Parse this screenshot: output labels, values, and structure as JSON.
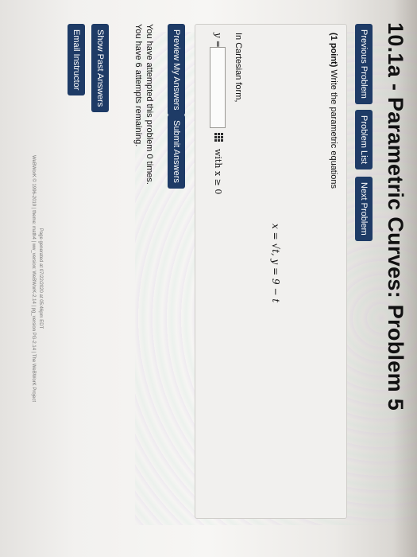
{
  "title": "10.1a - Parametric Curves: Problem 5",
  "nav": {
    "previous": "Previous Problem",
    "list": "Problem List",
    "next": "Next Problem"
  },
  "problem": {
    "points": "(1 point)",
    "instruction": "Write the parametric equations",
    "equations": "x = √t,    y = 9 − t",
    "cartesian_prompt": "In Cartesian form,",
    "answer_label": "y =",
    "answer_value": "",
    "constraint": "with x ≥ 0"
  },
  "actions": {
    "preview": "Preview My Answers",
    "submit": "Submit Answers"
  },
  "attempts": {
    "line1": "You have attempted this problem 0 times.",
    "line2": "You have 6 attempts remaining."
  },
  "side": {
    "show_past": "Show Past Answers",
    "email": "Email Instructor"
  },
  "footer": {
    "line1": "Page generated at 07/22/2020 at 05:46pm EDT",
    "line2": "WeBWorK © 1996-2019 | theme: math4 | ww_version: WeBWorK-2.14 | pg_version PG-2.14 | The WeBWorK Project"
  },
  "colors": {
    "button": "#1e3b66",
    "page_bg": "#f7f6f4",
    "problem_box": "#f1f0ee"
  }
}
